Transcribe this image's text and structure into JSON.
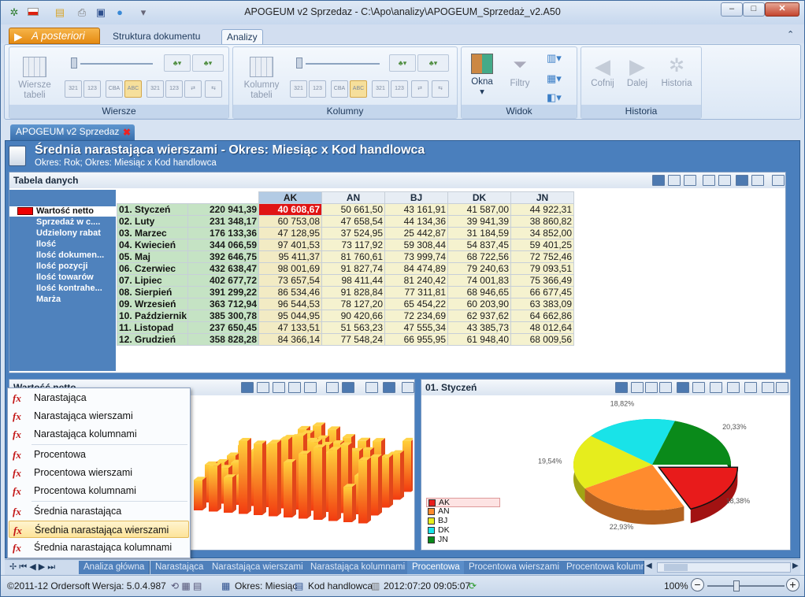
{
  "window": {
    "title": "APOGEUM v2 Sprzedaz - C:\\Apo\\analizy\\APOGEUM_Sprzedaż_v2.A50"
  },
  "ribbon": {
    "app_tab": "A posteriori",
    "tabs": [
      "Struktura dokumentu",
      "Analizy"
    ],
    "groups": {
      "wiersze": {
        "label": "Wiersze",
        "big_button": "Wiersze tabeli"
      },
      "kolumny": {
        "label": "Kolumny",
        "big_button": "Kolumny tabeli"
      },
      "widok": {
        "label": "Widok",
        "okna": "Okna",
        "filtry": "Filtry"
      },
      "historia": {
        "label": "Historia",
        "cofnij": "Cofnij",
        "dalej": "Dalej",
        "historia": "Historia"
      }
    },
    "small_labels": [
      "321",
      "123",
      "CBA",
      "ABC",
      "321",
      "123"
    ]
  },
  "document": {
    "tab_label": "APOGEUM v2 Sprzedaz",
    "title": "Średnia narastająca wierszami - Okres: Miesiąc x Kod handlowca",
    "subtitle": "Okres: Rok; Okres: Miesiąc x Kod handlowca"
  },
  "data_panel": {
    "title": "Tabela danych",
    "measures": [
      "Wartość netto",
      "Sprzedaż w c....",
      "Udzielony rabat",
      "Ilość",
      "Ilość dokumen...",
      "Ilość pozycji",
      "Ilość towarów",
      "Ilość kontrahe...",
      "Marża"
    ],
    "columns": [
      "AK",
      "AN",
      "BJ",
      "DK",
      "JN"
    ],
    "rows": [
      {
        "label": "01. Styczeń",
        "total": "220 941,39",
        "cells": [
          "40 608,67",
          "50 661,50",
          "43 161,91",
          "41 587,00",
          "44 922,31"
        ]
      },
      {
        "label": "02. Luty",
        "total": "231 348,17",
        "cells": [
          "60 753,08",
          "47 658,54",
          "44 134,36",
          "39 941,39",
          "38 860,82"
        ]
      },
      {
        "label": "03. Marzec",
        "total": "176 133,36",
        "cells": [
          "47 128,95",
          "37 524,95",
          "25 442,87",
          "31 184,59",
          "34 852,00"
        ]
      },
      {
        "label": "04. Kwiecień",
        "total": "344 066,59",
        "cells": [
          "97 401,53",
          "73 117,92",
          "59 308,44",
          "54 837,45",
          "59 401,25"
        ]
      },
      {
        "label": "05. Maj",
        "total": "392 646,75",
        "cells": [
          "95 411,37",
          "81 760,61",
          "73 999,74",
          "68 722,56",
          "72 752,46"
        ]
      },
      {
        "label": "06. Czerwiec",
        "total": "432 638,47",
        "cells": [
          "98 001,69",
          "91 827,74",
          "84 474,89",
          "79 240,63",
          "79 093,51"
        ]
      },
      {
        "label": "07. Lipiec",
        "total": "402 677,72",
        "cells": [
          "73 657,54",
          "98 411,44",
          "81 240,42",
          "74 001,83",
          "75 366,49"
        ]
      },
      {
        "label": "08. Sierpień",
        "total": "391 299,22",
        "cells": [
          "86 534,46",
          "91 828,84",
          "77 311,81",
          "68 946,65",
          "66 677,45"
        ]
      },
      {
        "label": "09. Wrzesień",
        "total": "363 712,94",
        "cells": [
          "96 544,53",
          "78 127,20",
          "65 454,22",
          "60 203,90",
          "63 383,09"
        ]
      },
      {
        "label": "10. Październik",
        "total": "385 300,78",
        "cells": [
          "95 044,95",
          "90 420,66",
          "72 234,69",
          "62 937,62",
          "64 662,86"
        ]
      },
      {
        "label": "11. Listopad",
        "total": "237 650,45",
        "cells": [
          "47 133,51",
          "51 563,23",
          "47 555,34",
          "43 385,73",
          "48 012,64"
        ]
      },
      {
        "label": "12. Grudzień",
        "total": "358 828,28",
        "cells": [
          "84 366,14",
          "77 548,24",
          "66 955,95",
          "61 948,40",
          "68 009,56"
        ]
      }
    ]
  },
  "chart3d_panel": {
    "title": "Wartość netto"
  },
  "menu": {
    "items": [
      "Narastająca",
      "Narastająca wierszami",
      "Narastająca kolumnami",
      "Procentowa",
      "Procentowa wierszami",
      "Procentowa kolumnami",
      "Średnia narastająca",
      "Średnia narastająca wierszami",
      "Średnia narastająca kolumnami"
    ],
    "selected": "Średnia narastająca wierszami"
  },
  "pie_panel": {
    "title": "01. Styczeń"
  },
  "chart_data": {
    "type": "pie",
    "title": "01. Styczeń",
    "categories": [
      "AK",
      "AN",
      "BJ",
      "DK",
      "JN"
    ],
    "values": [
      18.38,
      22.93,
      19.54,
      18.82,
      20.33
    ],
    "labels": [
      "18,38%",
      "22,93%",
      "19,54%",
      "18,82%",
      "20,33%"
    ],
    "colors": [
      "#e81b1b",
      "#ff8b2e",
      "#e6ed1d",
      "#19e3e8",
      "#0a8a1a"
    ],
    "legend_position": "left"
  },
  "sheet_tabs": [
    "Analiza główna",
    "Narastająca",
    "Narastająca wierszami",
    "Narastająca kolumnami",
    "Procentowa",
    "Procentowa wierszami",
    "Procentowa kolumn"
  ],
  "status": {
    "copyright": "©2011-12 Ordersoft",
    "version": "Wersja: 5.0.4.987",
    "dim1": "Okres: Miesiąc",
    "dim2": "Kod handlowca",
    "timestamp": "2012:07:20 09:05:07",
    "zoom": "100%"
  }
}
